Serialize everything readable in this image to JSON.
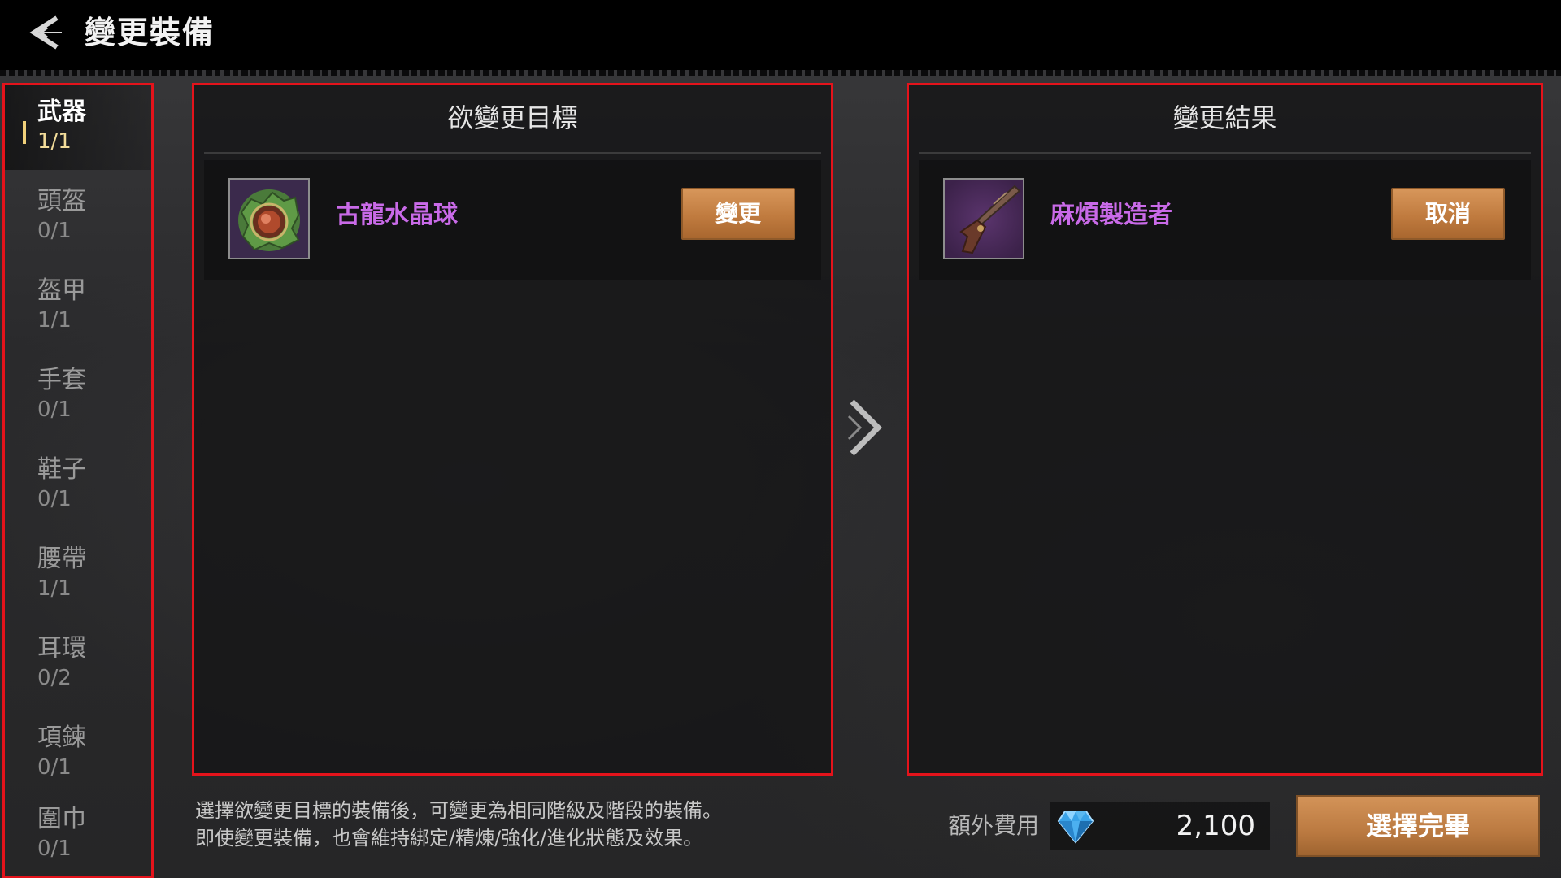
{
  "header": {
    "title": "變更裝備",
    "back_icon": "back-arrow-icon"
  },
  "sidebar": {
    "items": [
      {
        "label": "武器",
        "count": "1/1",
        "active": true
      },
      {
        "label": "頭盔",
        "count": "0/1",
        "active": false
      },
      {
        "label": "盔甲",
        "count": "1/1",
        "active": false
      },
      {
        "label": "手套",
        "count": "0/1",
        "active": false
      },
      {
        "label": "鞋子",
        "count": "0/1",
        "active": false
      },
      {
        "label": "腰帶",
        "count": "1/1",
        "active": false
      },
      {
        "label": "耳環",
        "count": "0/2",
        "active": false
      },
      {
        "label": "項鍊",
        "count": "0/1",
        "active": false
      },
      {
        "label": "圍巾",
        "count": "0/1",
        "active": false
      }
    ]
  },
  "target_panel": {
    "title": "欲變更目標",
    "item": {
      "name": "古龍水晶球",
      "icon": "crystal-orb-icon",
      "button_label": "變更"
    }
  },
  "result_panel": {
    "title": "變更結果",
    "item": {
      "name": "麻煩製造者",
      "icon": "gun-icon",
      "button_label": "取消"
    }
  },
  "footer": {
    "description_line1": "選擇欲變更目標的裝備後，可變更為相同階級及階段的裝備。",
    "description_line2": "即使變更裝備，也會維持綁定/精煉/強化/進化狀態及效果。",
    "fee_label": "額外費用",
    "fee_value": "2,100",
    "fee_icon": "diamond-icon",
    "complete_label": "選擇完畢"
  },
  "colors": {
    "highlight_border": "#e4131b",
    "item_name": "#c96ae8",
    "button": "#c07b3f",
    "active_count": "#f2dc9a"
  }
}
